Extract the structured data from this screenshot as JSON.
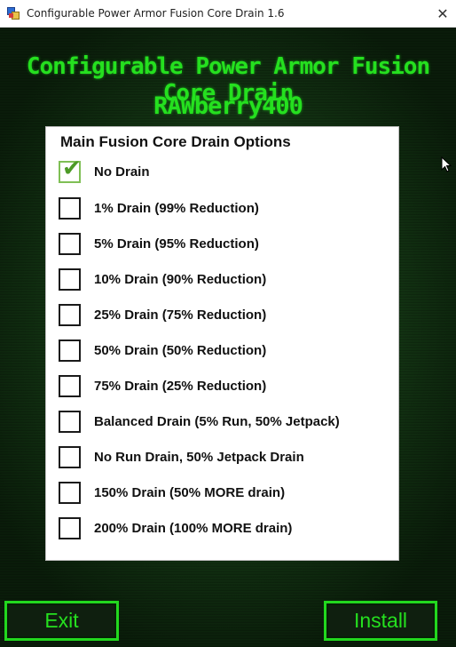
{
  "window": {
    "title": "Configurable Power Armor Fusion Core Drain 1.6",
    "close_glyph": "✕"
  },
  "header": {
    "title": "Configurable Power Armor Fusion Core Drain",
    "author": "RAWberry400",
    "text_color": "#25e01f"
  },
  "panel": {
    "title": "Main Fusion Core Drain Options",
    "options": [
      {
        "label": "No Drain",
        "checked": true
      },
      {
        "label": "1% Drain (99% Reduction)",
        "checked": false
      },
      {
        "label": "5% Drain (95% Reduction)",
        "checked": false
      },
      {
        "label": "10% Drain (90% Reduction)",
        "checked": false
      },
      {
        "label": "25% Drain (75% Reduction)",
        "checked": false
      },
      {
        "label": "50% Drain (50% Reduction)",
        "checked": false
      },
      {
        "label": "75% Drain (25% Reduction)",
        "checked": false
      },
      {
        "label": "Balanced Drain (5% Run, 50% Jetpack)",
        "checked": false
      },
      {
        "label": "No Run Drain, 50% Jetpack Drain",
        "checked": false
      },
      {
        "label": "150% Drain (50% MORE drain)",
        "checked": false
      },
      {
        "label": "200% Drain (100% MORE drain)",
        "checked": false
      }
    ]
  },
  "buttons": {
    "exit_label": "Exit",
    "install_label": "Install"
  },
  "icons": {
    "app": "app-icon",
    "close": "close-icon",
    "check": "checkmark-icon",
    "cursor": "mouse-pointer-icon"
  }
}
